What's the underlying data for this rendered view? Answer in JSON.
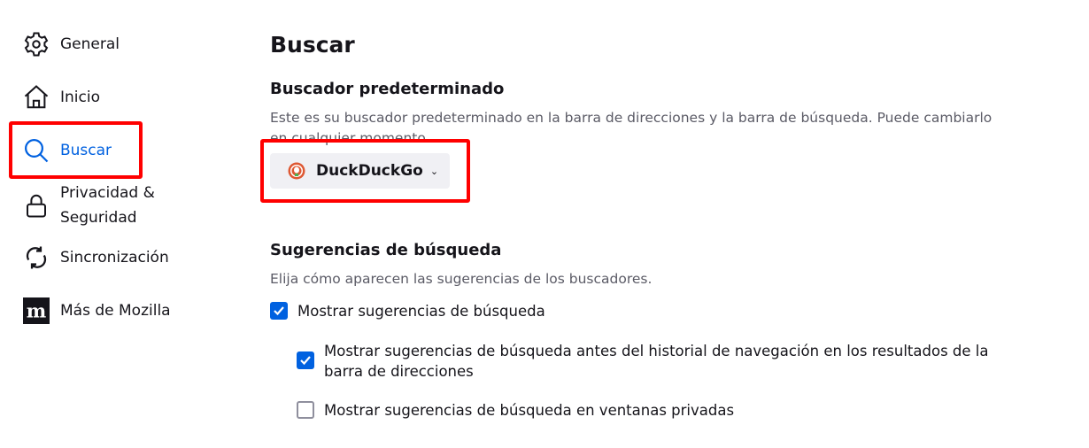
{
  "sidebar": {
    "items": [
      {
        "label": "General",
        "icon": "gear-icon"
      },
      {
        "label": "Inicio",
        "icon": "home-icon"
      },
      {
        "label": "Buscar",
        "icon": "search-icon",
        "active": true
      },
      {
        "label": "Privacidad &",
        "label2": "Seguridad",
        "icon": "lock-icon"
      },
      {
        "label": "Sincronización",
        "icon": "sync-icon"
      },
      {
        "label": "Más de Mozilla",
        "icon": "mozilla-icon"
      }
    ]
  },
  "main": {
    "title": "Buscar",
    "default_engine": {
      "heading": "Buscador predeterminado",
      "description": "Este es su buscador predeterminado en la barra de direcciones y la barra de búsqueda. Puede cambiarlo en cualquier momento.",
      "selected": "DuckDuckGo"
    },
    "suggestions": {
      "heading": "Sugerencias de búsqueda",
      "description": "Elija cómo aparecen las sugerencias de los buscadores.",
      "options": [
        {
          "label": "Mostrar sugerencias de búsqueda",
          "checked": true
        },
        {
          "label": "Mostrar sugerencias de búsqueda antes del historial de navegación en los resultados de la barra de direcciones",
          "checked": true
        },
        {
          "label": "Mostrar sugerencias de búsqueda en ventanas privadas",
          "checked": false
        }
      ]
    }
  },
  "colors": {
    "accent": "#0061e0",
    "highlight": "#ff0000"
  }
}
